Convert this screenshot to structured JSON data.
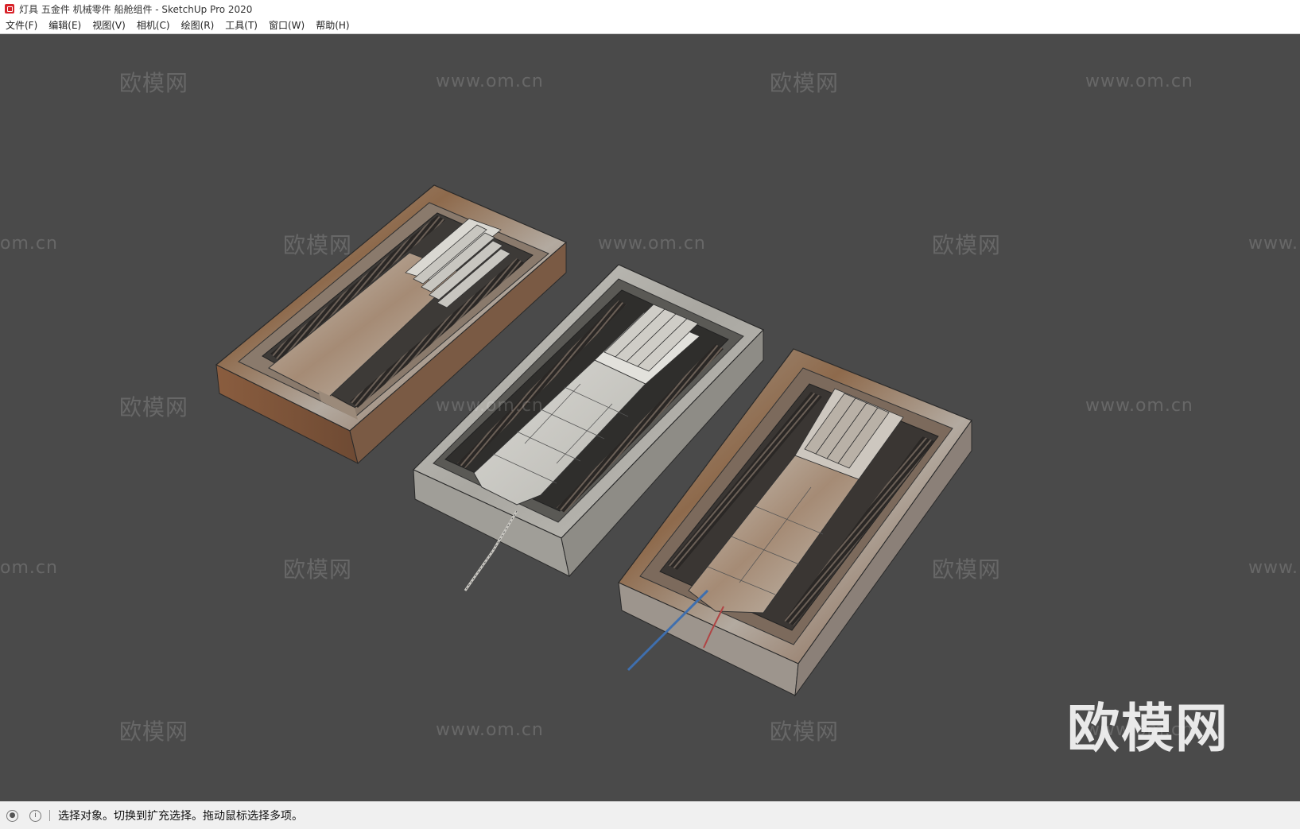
{
  "window": {
    "title": "灯具 五金件 机械零件 船舱组件 - SketchUp Pro 2020"
  },
  "menu": [
    {
      "label": "文件(F)"
    },
    {
      "label": "编辑(E)"
    },
    {
      "label": "视图(V)"
    },
    {
      "label": "相机(C)"
    },
    {
      "label": "绘图(R)"
    },
    {
      "label": "工具(T)"
    },
    {
      "label": "窗口(W)"
    },
    {
      "label": "帮助(H)"
    }
  ],
  "watermark": {
    "brand": "欧模网",
    "url": "www.om.cn",
    "partial_url_left": "om.cn",
    "partial_url_right": "www."
  },
  "status": {
    "text": "选择对象。切换到扩充选择。拖动鼠标选择多项。",
    "icons": [
      "geo-location-icon",
      "info-icon"
    ]
  },
  "colors": {
    "viewport_bg": "#4a4a4a",
    "rust": "#8a5a3c",
    "metal": "#b8b6b0"
  }
}
